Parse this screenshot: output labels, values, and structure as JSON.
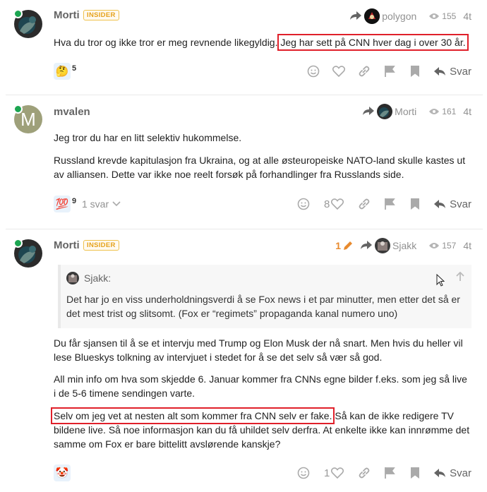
{
  "posts": [
    {
      "author": "Morti",
      "badge": "INSIDER",
      "reply_to": "polygon",
      "views": "155",
      "age": "4t",
      "paragraphs": [
        {
          "before": "Hva du tror og ikke tror er meg revnende likegyldig. ",
          "highlight": "Jeg har sett på CNN hver dag i over 30 år.",
          "after": ""
        }
      ],
      "reaction": {
        "emoji": "🤔",
        "count": "5"
      },
      "like_count": "",
      "reply_label": "Svar"
    },
    {
      "author": "mvalen",
      "avatar_letter": "M",
      "reply_to": "Morti",
      "views": "161",
      "age": "4t",
      "paragraphs": [
        "Jeg tror du har en litt selektiv hukommelse.",
        "Russland krevde kapitulasjon fra Ukraina, og at alle østeuropeiske NATO-land skulle kastes ut av alliansen. Dette var ikke noe reelt forsøk på forhandlinger fra Russlands side."
      ],
      "reaction": {
        "emoji": "💯",
        "count": "9"
      },
      "replies_label": "1 svar",
      "like_count": "8",
      "reply_label": "Svar"
    },
    {
      "author": "Morti",
      "badge": "INSIDER",
      "edit_count": "1",
      "reply_to": "Sjakk",
      "views": "157",
      "age": "4t",
      "quote": {
        "author": "Sjakk:",
        "text": "Det har jo en viss underholdningsverdi å se Fox news i et par minutter, men etter det så er det mest trist og slitsomt. (Fox er “regimets” propaganda kanal numero uno)"
      },
      "paragraphs": [
        "Du får sjansen til å se et intervju med Trump og Elon Musk der nå snart. Men hvis du heller vil lese Blueskys tolkning av intervjuet i stedet for å se det selv så vær så god.",
        "All min info om hva som skjedde 6. Januar kommer fra CNNs egne bilder f.eks. som jeg så live i de 5-6 timene sendingen varte."
      ],
      "last_paragraph": {
        "highlight": "Selv om jeg vet at nesten alt som kommer fra CNN selv er fake.",
        "after": " Så kan de ikke redigere TV bildene live. Så noe informasjon kan du få uhildet selv derfra. At enkelte ikke kan innrømme det samme om Fox er bare bittelitt avslørende kanskje?"
      },
      "reaction": {
        "emoji": "🤡",
        "count": ""
      },
      "like_count": "1",
      "reply_label": "Svar"
    }
  ],
  "colors": {
    "highlight": "#e0202a",
    "badge": "#e5a21c",
    "online": "#1ca551",
    "edit": "#e88a2e"
  }
}
